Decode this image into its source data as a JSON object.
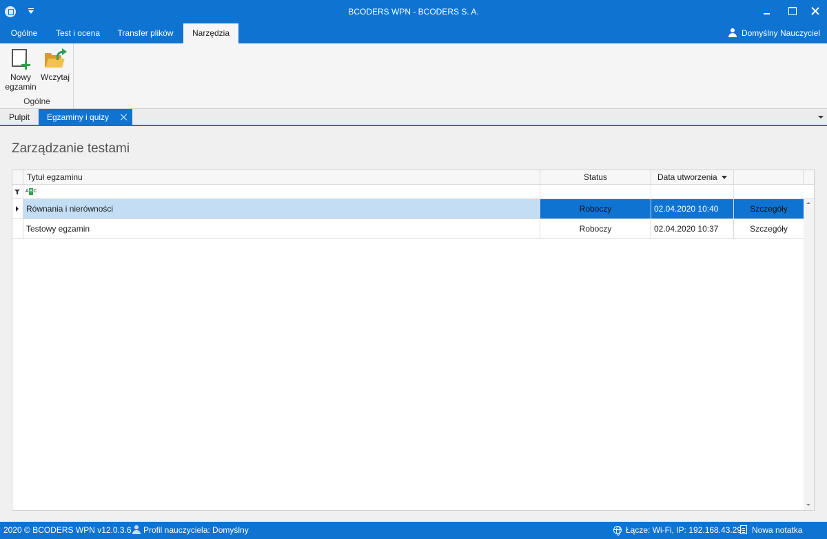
{
  "window": {
    "title": "BCODERS WPN - BCODERS S. A."
  },
  "ribbon": {
    "tabs": [
      {
        "label": "Ogólne"
      },
      {
        "label": "Test i ocena"
      },
      {
        "label": "Transfer plików"
      },
      {
        "label": "Narzędzia",
        "active": true
      }
    ],
    "user": "Domyślny Nauczyciel",
    "group": {
      "label": "Ogólne",
      "buttons": [
        {
          "label_line1": "Nowy",
          "label_line2": "egzamin",
          "icon": "new-document-plus-icon"
        },
        {
          "label": "Wczytaj",
          "icon": "open-folder-icon"
        }
      ]
    }
  },
  "doc_tabs": [
    {
      "label": "Pulpit"
    },
    {
      "label": "Egzaminy i quizy",
      "active": true,
      "closable": true
    }
  ],
  "page": {
    "title": "Zarządzanie testami"
  },
  "grid": {
    "columns": [
      {
        "label": "Tytuł egzaminu"
      },
      {
        "label": "Status"
      },
      {
        "label": "Data utworzenia",
        "sorted": "desc"
      },
      {
        "label": ""
      }
    ],
    "filter_icon_text": "ABC",
    "rows": [
      {
        "title": "Równania i nierówności",
        "status": "Roboczy",
        "date": "02.04.2020 10:40",
        "action": "Szczegóły",
        "selected": true
      },
      {
        "title": "Testowy egzamin",
        "status": "Roboczy",
        "date": "02.04.2020 10:37",
        "action": "Szczegóły",
        "selected": false
      }
    ]
  },
  "statusbar": {
    "copyright": "2020 ©  BCODERS WPN v12.0.3.6",
    "profile": "Profil nauczyciela: Domyślny",
    "connection": "Łącze: Wi-Fi, IP: 192.168.43.29",
    "note": "Nowa notatka"
  },
  "colors": {
    "accent": "#0f73d1",
    "selection_light": "#c2ddf4",
    "green": "#2fa14a",
    "folder": "#f2c14e"
  }
}
